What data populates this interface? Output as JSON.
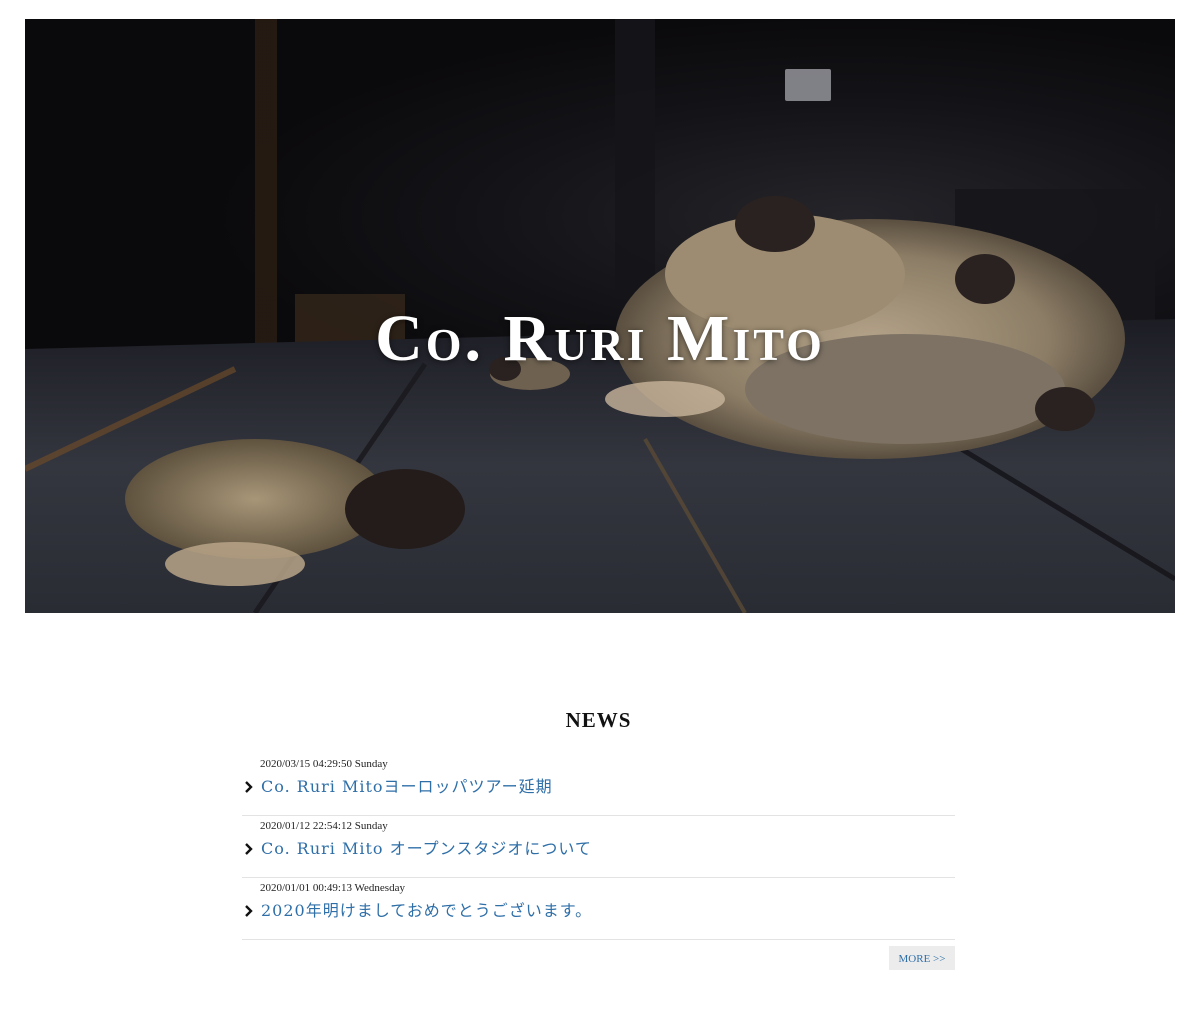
{
  "hero": {
    "title": "Co. Ruri Mito"
  },
  "news": {
    "heading": "NEWS",
    "items": [
      {
        "date": "2020/03/15 04:29:50 Sunday",
        "title": "Co. Ruri Mitoヨーロッパツアー延期"
      },
      {
        "date": "2020/01/12 22:54:12 Sunday",
        "title": "Co. Ruri Mito オープンスタジオについて"
      },
      {
        "date": "2020/01/01 00:49:13 Wednesday",
        "title": "2020年明けましておめでとうございます。"
      }
    ],
    "more_label": "MORE >>"
  },
  "colors": {
    "link": "#2f6fa8",
    "more_bg": "#ececec",
    "divider": "#e3e3e3"
  },
  "icons": {
    "news_bullet": "chevron-right-icon"
  }
}
